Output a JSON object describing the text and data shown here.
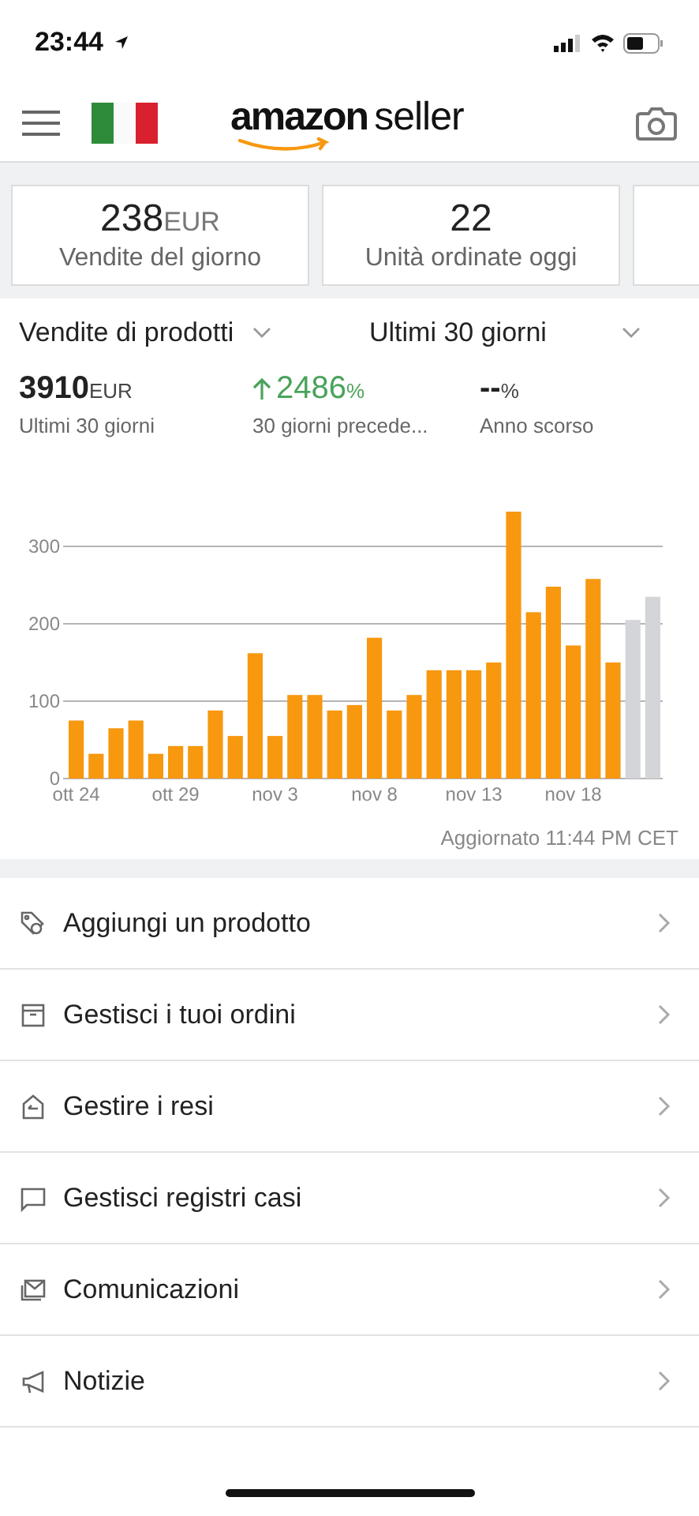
{
  "status_bar": {
    "time": "23:44"
  },
  "header": {
    "logo_brand": "amazon",
    "logo_suffix": "seller"
  },
  "metric_cards": [
    {
      "value": "238",
      "unit": "EUR",
      "label": "Vendite del giorno"
    },
    {
      "value": "22",
      "label": "Unità ordinate oggi"
    }
  ],
  "filters": [
    {
      "label": "Vendite di prodotti"
    },
    {
      "label": "Ultimi 30 giorni"
    }
  ],
  "stats": [
    {
      "kind": "plain",
      "value": "3910",
      "unit": "EUR",
      "label": "Ultimi 30 giorni"
    },
    {
      "kind": "up",
      "value": "2486",
      "unit": "%",
      "label": "30 giorni precede..."
    },
    {
      "kind": "plain",
      "value": "--",
      "unit": "%",
      "label": "Anno scorso"
    }
  ],
  "chart": {
    "chart_data": {
      "type": "bar",
      "stacked": true,
      "grid": true,
      "categories": [
        "ott 24",
        null,
        null,
        null,
        null,
        "ott 29",
        null,
        null,
        null,
        null,
        "nov 3",
        null,
        null,
        null,
        null,
        "nov 8",
        null,
        null,
        null,
        null,
        "nov 13",
        null,
        null,
        null,
        null,
        "nov 18",
        null,
        null,
        null,
        null
      ],
      "series": [
        {
          "color": "#f7980f",
          "values": [
            75,
            32,
            65,
            75,
            32,
            42,
            42,
            88,
            55,
            162,
            55,
            108,
            108,
            88,
            95,
            182,
            88,
            108,
            140,
            140,
            140,
            150,
            345,
            215,
            248,
            172,
            258,
            150,
            null,
            null
          ]
        },
        {
          "color": "#d4d5d8",
          "values": [
            null,
            null,
            null,
            null,
            null,
            null,
            null,
            null,
            null,
            null,
            null,
            null,
            null,
            null,
            null,
            null,
            null,
            null,
            null,
            null,
            null,
            null,
            null,
            null,
            null,
            null,
            null,
            null,
            205,
            235
          ]
        }
      ],
      "ylim": [
        0,
        345
      ],
      "yticks": [
        0,
        100,
        200,
        300
      ]
    },
    "updated": "Aggiornato 11:44 PM CET"
  },
  "menu": [
    {
      "kind": "tag",
      "label": "Aggiungi un prodotto"
    },
    {
      "kind": "box",
      "label": "Gestisci i tuoi ordini"
    },
    {
      "kind": "return",
      "label": "Gestire i resi"
    },
    {
      "kind": "chat",
      "label": "Gestisci registri casi"
    },
    {
      "kind": "mail",
      "label": "Comunicazioni"
    },
    {
      "kind": "megaphone",
      "label": "Notizie"
    }
  ]
}
